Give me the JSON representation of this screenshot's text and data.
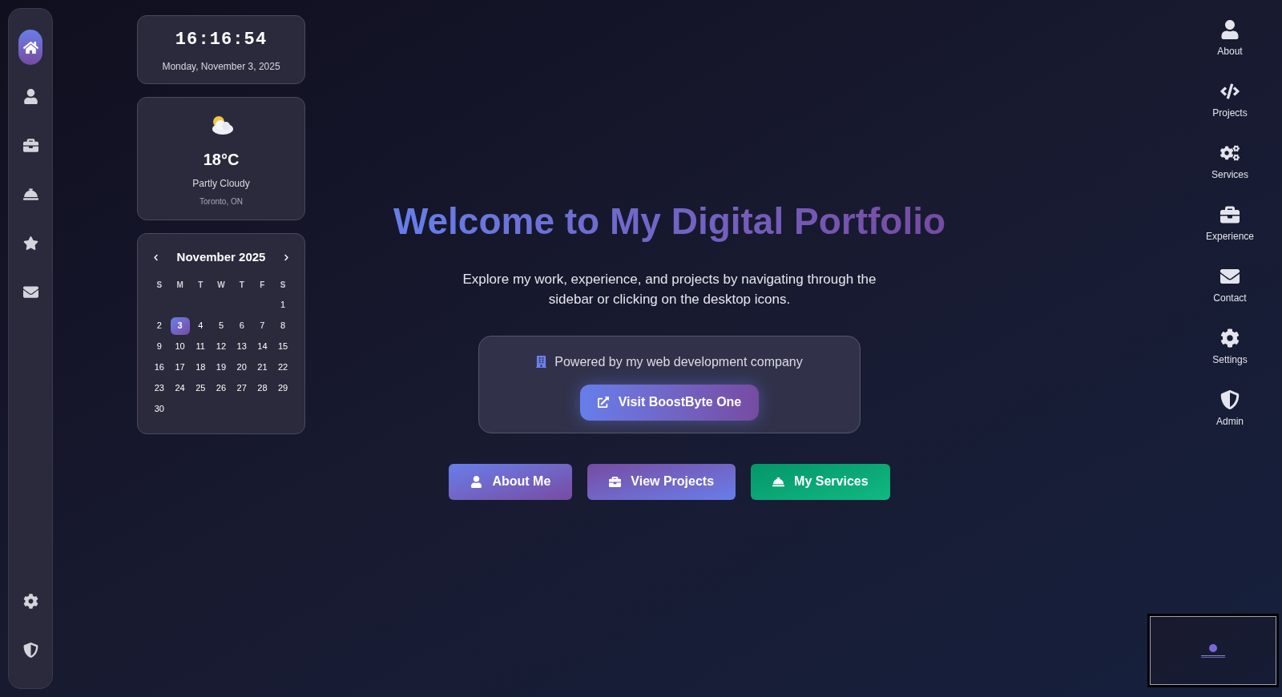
{
  "sidebar": {
    "items": [
      {
        "selected": true
      },
      {
        "selected": false
      },
      {
        "selected": false
      },
      {
        "selected": false
      },
      {
        "selected": false
      },
      {
        "selected": false
      }
    ],
    "bottom_items": [
      {
        "selected": false
      },
      {
        "selected": false
      }
    ]
  },
  "clock": {
    "time": "16:16:54",
    "date": "Monday, November 3, 2025"
  },
  "weather": {
    "temperature": "18°C",
    "condition": "Partly Cloudy",
    "location": "Toronto, ON"
  },
  "calendar": {
    "month": "November 2025",
    "weekdays": [
      "S",
      "M",
      "T",
      "W",
      "T",
      "F",
      "S"
    ],
    "weeks": [
      [
        {
          "day": "1",
          "selected": false
        }
      ],
      [
        {
          "day": "2",
          "selected": false
        },
        {
          "day": "3",
          "selected": true
        },
        {
          "day": "4",
          "selected": false
        },
        {
          "day": "5",
          "selected": false
        },
        {
          "day": "6",
          "selected": false
        },
        {
          "day": "7",
          "selected": false
        },
        {
          "day": "8",
          "selected": false
        }
      ],
      [
        {
          "day": "9",
          "selected": false
        },
        {
          "day": "10",
          "selected": false
        },
        {
          "day": "11",
          "selected": false
        },
        {
          "day": "12",
          "selected": false
        },
        {
          "day": "13",
          "selected": false
        },
        {
          "day": "14",
          "selected": false
        },
        {
          "day": "15",
          "selected": false
        }
      ],
      [
        {
          "day": "16",
          "selected": false
        },
        {
          "day": "17",
          "selected": false
        },
        {
          "day": "18",
          "selected": false
        },
        {
          "day": "19",
          "selected": false
        },
        {
          "day": "20",
          "selected": false
        },
        {
          "day": "21",
          "selected": false
        },
        {
          "day": "22",
          "selected": false
        }
      ],
      [
        {
          "day": "23",
          "selected": false
        },
        {
          "day": "24",
          "selected": false
        },
        {
          "day": "25",
          "selected": false
        },
        {
          "day": "26",
          "selected": false
        },
        {
          "day": "27",
          "selected": false
        },
        {
          "day": "28",
          "selected": false
        },
        {
          "day": "29",
          "selected": false
        }
      ],
      [
        {
          "day": "30",
          "selected": false
        }
      ]
    ]
  },
  "hero": {
    "title": "Welcome to My Digital Portfolio",
    "subtitle": "Explore my work, experience, and projects by navigating through the sidebar or clicking on the desktop icons.",
    "company": {
      "text": "Powered by my web development company",
      "button": "Visit BoostByte One"
    },
    "buttons": [
      {
        "label": "About Me",
        "kind": "blue"
      },
      {
        "label": "View Projects",
        "kind": "purple"
      },
      {
        "label": "My Services",
        "kind": "green"
      }
    ]
  },
  "desktop_icons": [
    {
      "label": "About"
    },
    {
      "label": "Projects"
    },
    {
      "label": "Services"
    },
    {
      "label": "Experience"
    },
    {
      "label": "Contact"
    },
    {
      "label": "Settings"
    },
    {
      "label": "Admin"
    }
  ]
}
